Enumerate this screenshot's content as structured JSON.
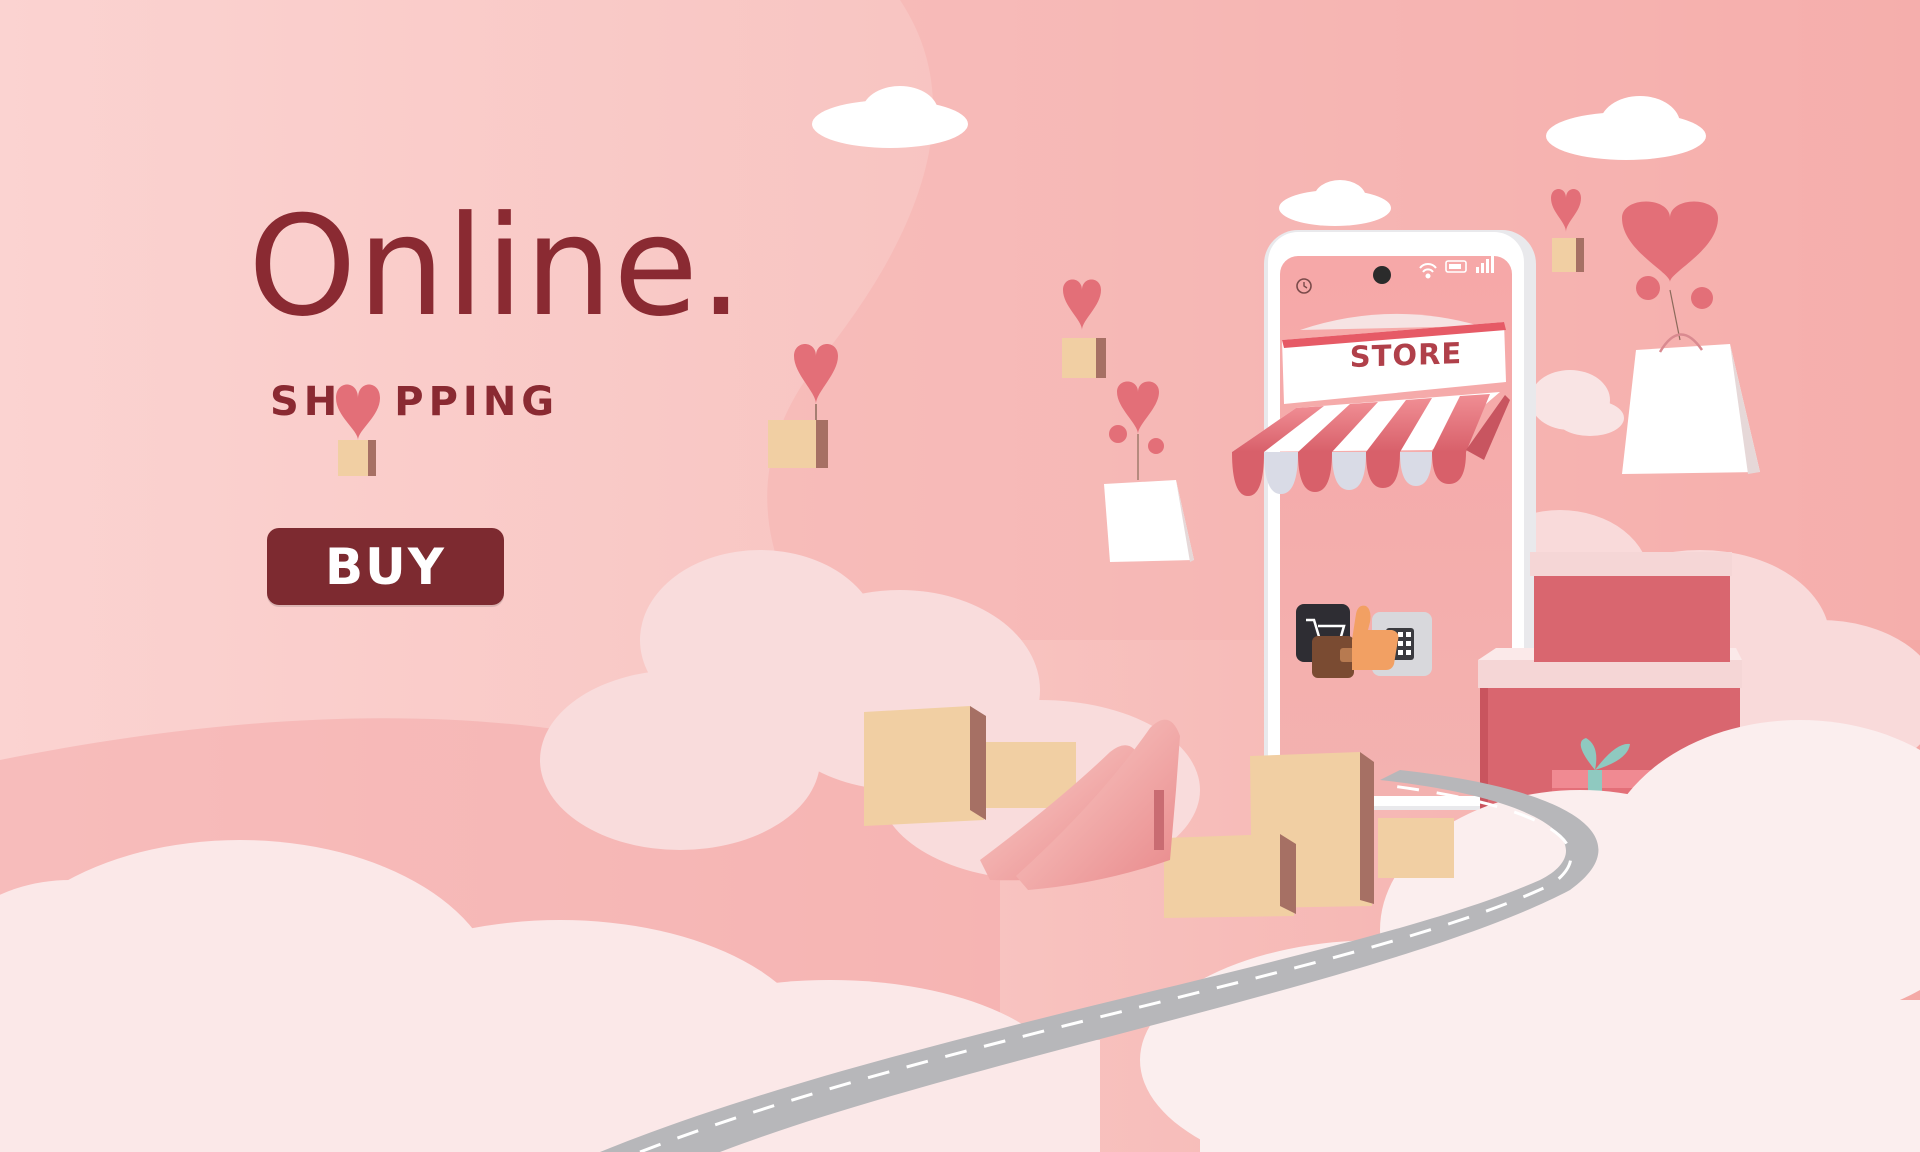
{
  "hero": {
    "title": "Online.",
    "subtitle_before": "SH",
    "subtitle_after": "PPING",
    "cta_label": "BUY"
  },
  "phone": {
    "store_sign": "STORE",
    "status_icons": [
      "clock-icon",
      "wifi-icon",
      "battery-icon",
      "signal-icon"
    ]
  },
  "icons": [
    "heart-balloon-icon",
    "cardboard-box-icon",
    "shopping-bag-icon",
    "cloud-icon",
    "cart-icon",
    "wallet-icon",
    "thumbs-up-icon",
    "calculator-icon",
    "high-heel-shoe-icon",
    "gift-box-icon",
    "road-icon"
  ],
  "colors": {
    "background": "#f6b9b6",
    "brand_dark": "#8a2a32",
    "button": "#7d2a30",
    "accent_pink": "#e36f78",
    "cloud": "#fbe6e6"
  }
}
